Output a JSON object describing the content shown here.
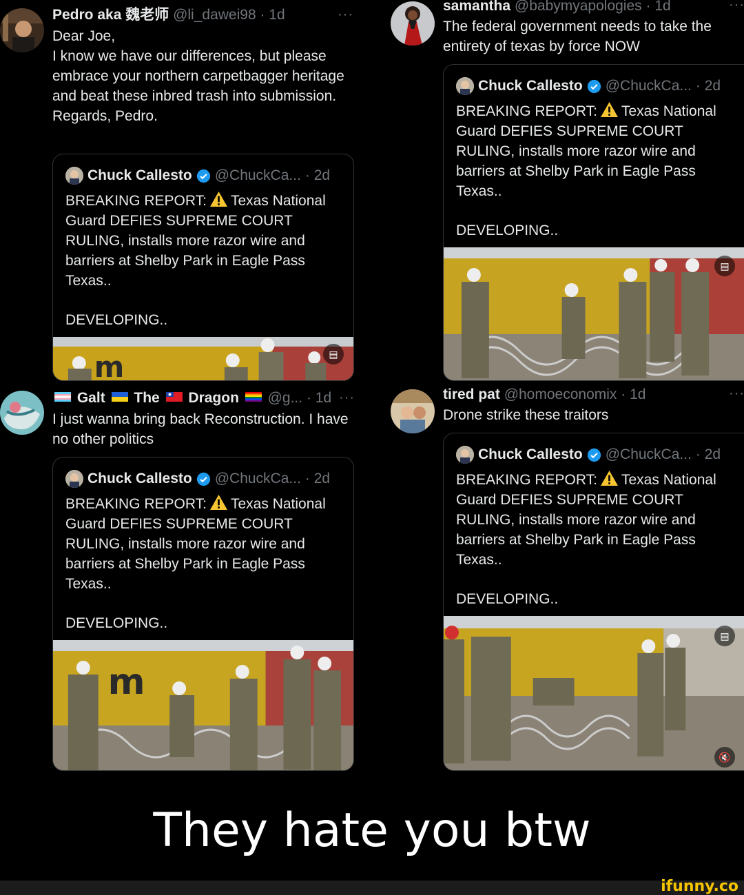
{
  "tweets": [
    {
      "name": "Pedro aka 魏老师",
      "handle": "@li_dawei98",
      "time": "· 1d",
      "more": "···",
      "text": "Dear Joe,\nI know we have our differences, but please embrace your northern carpetbagger heritage and beat these inbred trash into submission.\nRegards, Pedro."
    },
    {
      "name": "samantha",
      "handle": "@babymyapologies",
      "time": "· 1d",
      "more": "···",
      "text": "The federal government needs to take the entirety of texas by force NOW"
    },
    {
      "name_parts": [
        "Galt",
        "The",
        "Dragon"
      ],
      "handle": "@g...",
      "time": "· 1d",
      "more": "···",
      "text": "I just wanna bring back Reconstruction. I have no other politics"
    },
    {
      "name": "tired pat",
      "handle": "@homoeconomix",
      "time": "· 1d",
      "more": "···",
      "text": "Drone strike these traitors"
    }
  ],
  "quoted": {
    "name": "Chuck Callesto",
    "handle": "@ChuckCa...",
    "time": "· 2d",
    "text_before_icon": "BREAKING REPORT:",
    "text_after_icon": "Texas National Guard DEFIES SUPREME COURT RULING, installs more razor wire and barriers at Shelby Park in Eagle Pass Texas..",
    "developing": "DEVELOPING..",
    "warning_icon": "warning-icon",
    "verified_icon": "verified-badge-icon"
  },
  "caption": "They hate you btw",
  "watermark": "ifunny.co",
  "colors": {
    "background": "#000000",
    "text": "#e7e9ea",
    "muted": "#71767b",
    "border": "#2f3336",
    "verified": "#1d9bf0",
    "watermark": "#f5c400"
  }
}
